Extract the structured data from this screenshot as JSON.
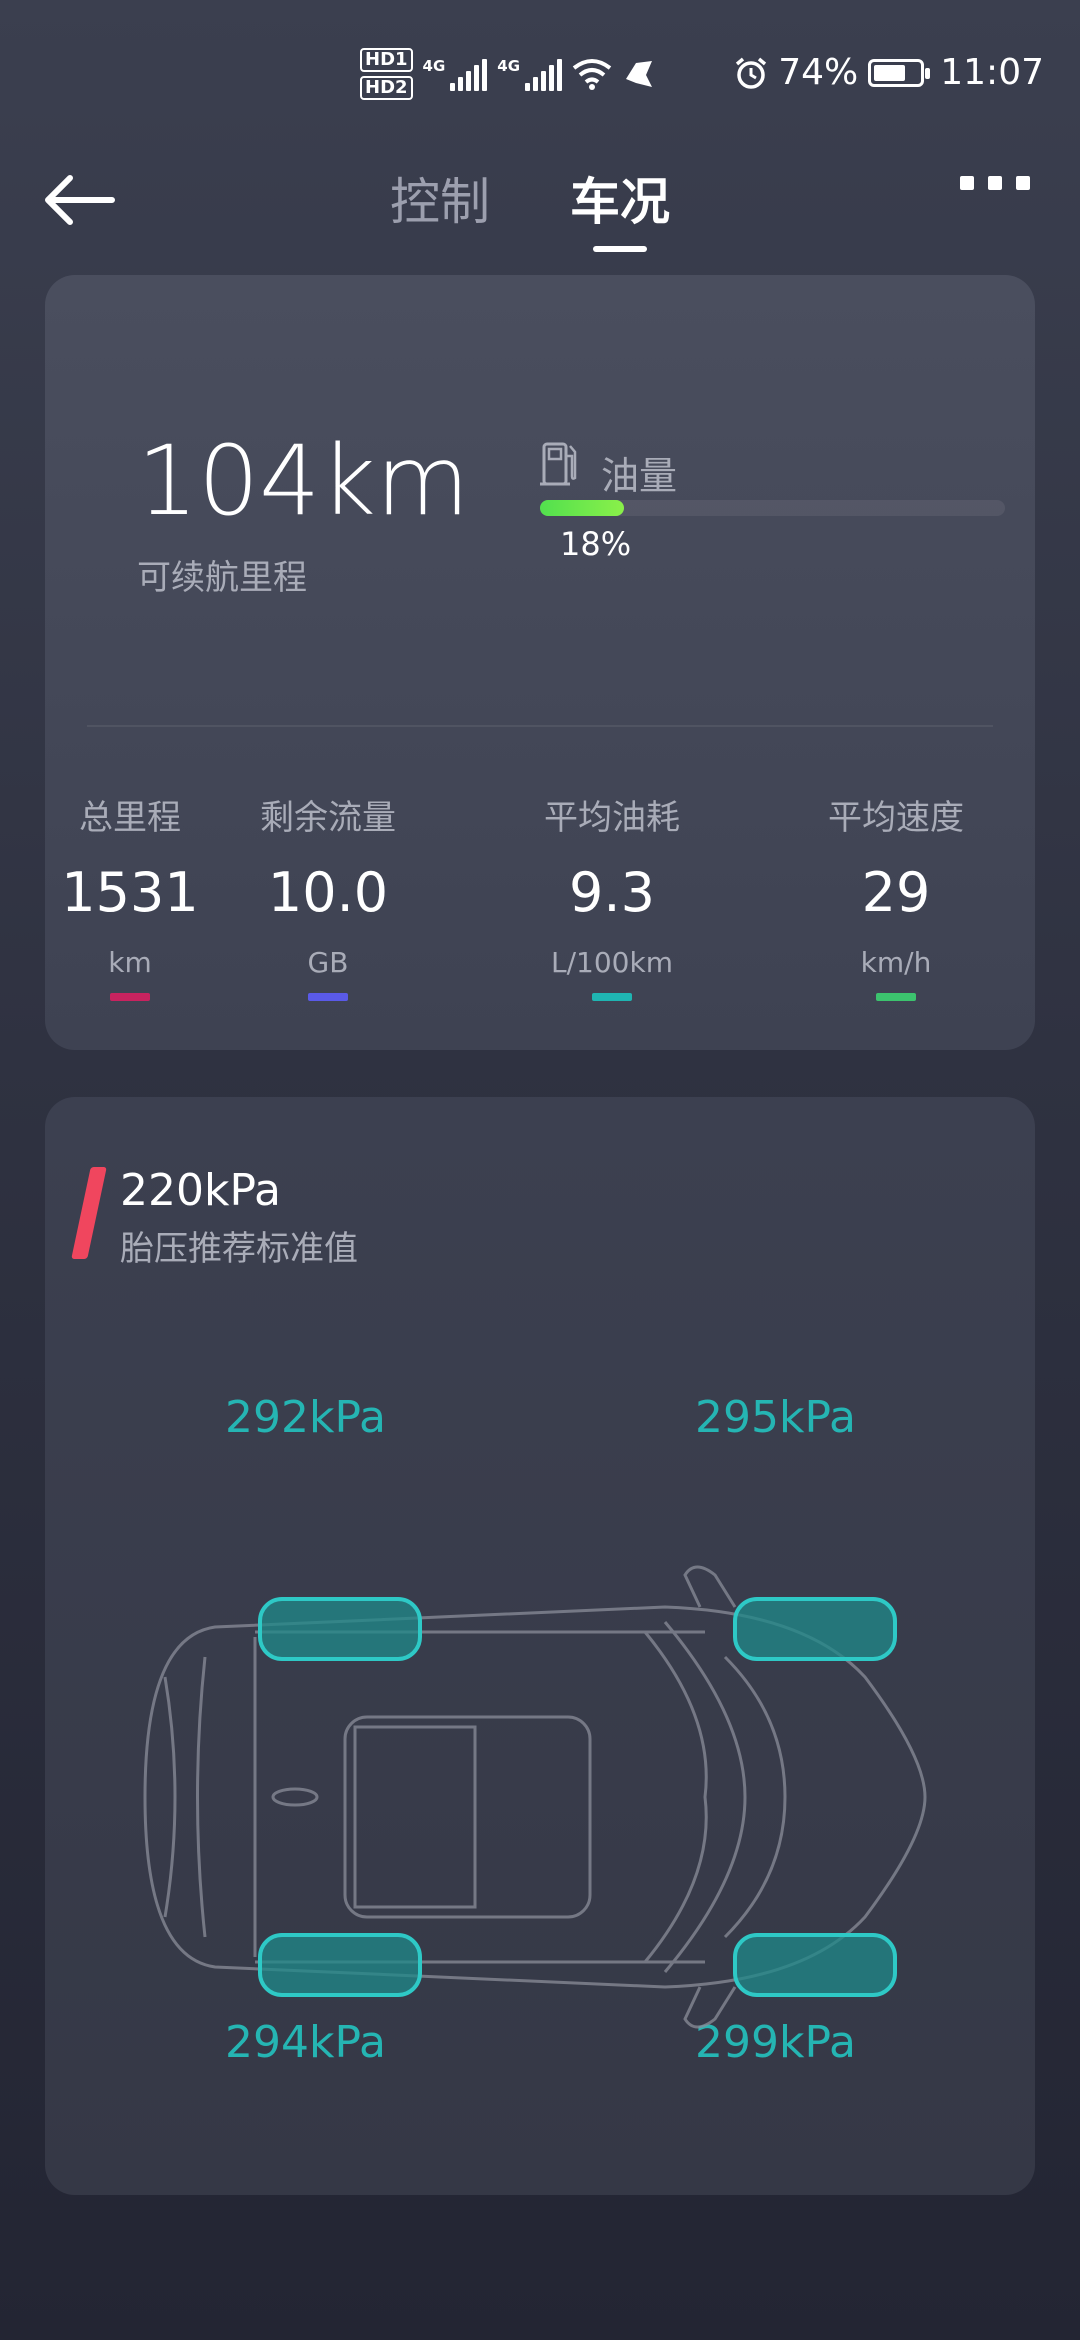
{
  "status_bar": {
    "hd1": "HD1",
    "hd2": "HD2",
    "net1": "4G",
    "net2": "4G",
    "alarm_icon": "alarm-icon",
    "battery_percent": "74%",
    "battery_level": 0.74,
    "time": "11:07"
  },
  "header": {
    "tabs": [
      {
        "label": "控制",
        "active": false
      },
      {
        "label": "车况",
        "active": true
      }
    ],
    "back_icon": "arrow-left-icon",
    "more_icon": "more-icon"
  },
  "range": {
    "value": "104km",
    "label": "可续航里程"
  },
  "fuel": {
    "label": "油量",
    "percent_text": "18%",
    "level": 0.18,
    "bar_color": "#52e04e"
  },
  "stats": [
    {
      "title": "总里程",
      "value": "1531",
      "unit": "km",
      "color": "#c8235f"
    },
    {
      "title": "剩余流量",
      "value": "10.0",
      "unit": "GB",
      "color": "#5a5ae8"
    },
    {
      "title": "平均油耗",
      "value": "9.3",
      "unit": "L/100km",
      "color": "#1fb5b2"
    },
    {
      "title": "平均速度",
      "value": "29",
      "unit": "km/h",
      "color": "#3cc36e"
    }
  ],
  "tire": {
    "standard_value": "220kPa",
    "standard_label": "胎压推荐标准值",
    "front_left": "292kPa",
    "front_right": "295kPa",
    "rear_left": "294kPa",
    "rear_right": "299kPa",
    "accent_color": "#25b5b3"
  }
}
